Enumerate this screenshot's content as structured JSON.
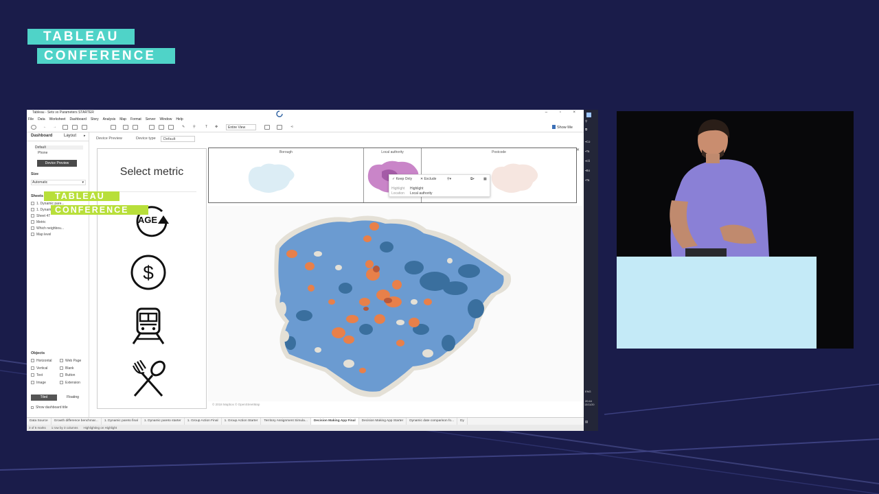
{
  "event_logo": {
    "line1": "TABLEAU",
    "line2": "CONFERENCE"
  },
  "podium_logo": {
    "line1": "TABLEAU",
    "line2": "CONFERENCE"
  },
  "window": {
    "title": "Tableau - Sets vs Parameters STARTER",
    "controls": "– ▫ ×"
  },
  "menu": [
    "File",
    "Data",
    "Worksheet",
    "Dashboard",
    "Story",
    "Analysis",
    "Map",
    "Format",
    "Server",
    "Window",
    "Help"
  ],
  "toolbar": {
    "view_select": "Entire View",
    "show_me": "Show Me"
  },
  "left_panel": {
    "tabs": [
      "Dashboard",
      "Layout"
    ],
    "devices": [
      "Default",
      "Phone"
    ],
    "device_preview_button": "Device Preview",
    "size_label": "Size",
    "size_value": "Automatic",
    "sheets_label": "Sheets",
    "sheets": [
      "1. Dynamic pare...",
      "1. Dynamic pare...",
      "Sheet 47",
      "Metric",
      "Which neighbou...",
      "Map level"
    ],
    "objects_label": "Objects",
    "objects": [
      "Horizontal",
      "Web Page",
      "Vertical",
      "Blank",
      "Text",
      "Button",
      "Image",
      "Extension"
    ],
    "tiled": "Tiled",
    "floating": "Floating",
    "show_title": "Show dashboard title"
  },
  "device_bar": {
    "preview": "Device Preview",
    "type_label": "Device type",
    "type_value": "Default"
  },
  "metric_panel": {
    "title": "Select metric",
    "icons": [
      "age-icon",
      "dollar-icon",
      "train-icon",
      "fork-spoon-icon"
    ],
    "age_text": "AGE"
  },
  "mini_maps": {
    "columns": [
      "Borough",
      "Local authority",
      "Postcode"
    ]
  },
  "tooltip": {
    "keep_only": "Keep Only",
    "exclude": "Exclude",
    "row1_label": "Highlight",
    "row1_value": "Highlight",
    "row2_label": "Location",
    "row2_value": "Local authority"
  },
  "map": {
    "credit": "© 2018 Mapbox © OpenStreetMap",
    "colors": {
      "blue": "#6b9bd1",
      "dark_blue": "#3a6f9e",
      "orange": "#e8804a",
      "dark_orange": "#b8583a",
      "neutral": "#e4e0d6"
    }
  },
  "sheet_tabs": [
    "Data Source",
    "Growth difference benchmar...",
    "1. Dynamic pareto final",
    "1. Dynamic pareto starter",
    "1. Group Action Final",
    "1. Group Action Starter",
    "Territory Assignment Simula...",
    "Decision Making App Final",
    "Decision Making App Starter",
    "Dynamic date comparison fo...",
    "Dy"
  ],
  "active_sheet_tab": "Decision Making App Final",
  "status_bar": [
    "3 of 5 marks",
    "1 row by 3 columns",
    "Highlighting on Highlight"
  ],
  "taskbar": {
    "lang": "ENG",
    "time": "20:44",
    "date": "13/11/20"
  },
  "taskbar_items": [
    "Co",
    "Ta",
    "Cli",
    "Bo",
    "Ta"
  ]
}
